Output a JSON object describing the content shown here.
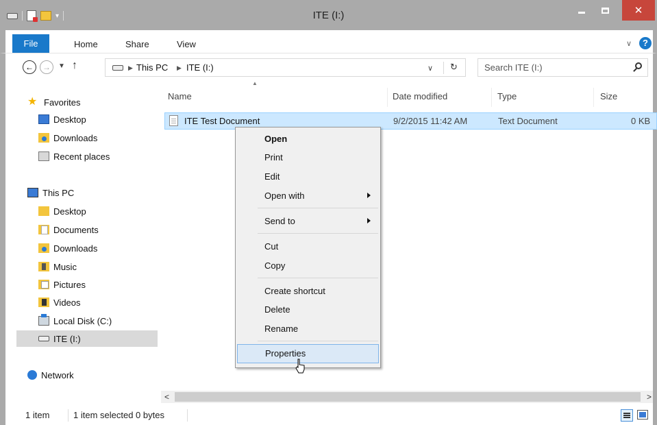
{
  "window": {
    "title": "ITE (I:)"
  },
  "ribbon": {
    "tabs": {
      "file": "File",
      "home": "Home",
      "share": "Share",
      "view": "View"
    }
  },
  "address": {
    "crumbs": [
      "This PC",
      "ITE (I:)"
    ],
    "search_placeholder": "Search ITE (I:)"
  },
  "nav": {
    "favorites": {
      "label": "Favorites",
      "items": [
        "Desktop",
        "Downloads",
        "Recent places"
      ]
    },
    "this_pc": {
      "label": "This PC",
      "items": [
        "Desktop",
        "Documents",
        "Downloads",
        "Music",
        "Pictures",
        "Videos",
        "Local Disk (C:)",
        "ITE (I:)"
      ]
    },
    "network": {
      "label": "Network"
    }
  },
  "columns": {
    "name": "Name",
    "date": "Date modified",
    "type": "Type",
    "size": "Size"
  },
  "files": [
    {
      "name": "ITE Test Document",
      "date": "9/2/2015 11:42 AM",
      "type": "Text Document",
      "size": "0 KB"
    }
  ],
  "context_menu": {
    "open": "Open",
    "print": "Print",
    "edit": "Edit",
    "open_with": "Open with",
    "send_to": "Send to",
    "cut": "Cut",
    "copy": "Copy",
    "create_shortcut": "Create shortcut",
    "delete": "Delete",
    "rename": "Rename",
    "properties": "Properties"
  },
  "status": {
    "count": "1 item",
    "selected": "1 item selected 0 bytes"
  },
  "colors": {
    "accent": "#1979ca",
    "selection": "#cce8ff",
    "close": "#c7463b",
    "frame": "#aaaaaa"
  }
}
